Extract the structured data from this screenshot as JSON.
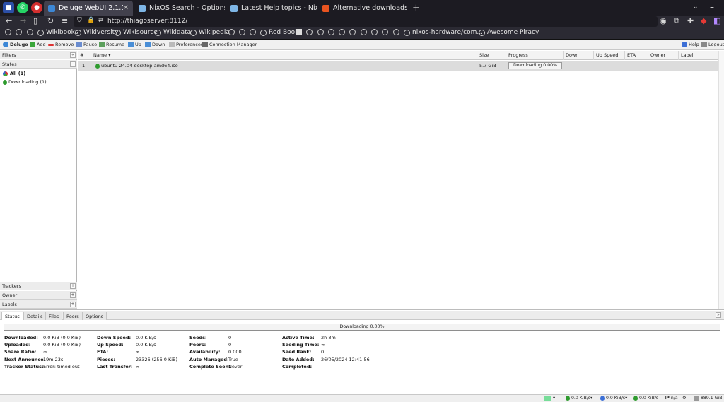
{
  "browser": {
    "tabs": [
      {
        "label": "Deluge WebUI 2.1.1",
        "active": true
      },
      {
        "label": "NixOS Search - Options - al"
      },
      {
        "label": "Latest Help topics - NixOS D"
      },
      {
        "label": "Alternative downloads | Ubu"
      }
    ],
    "url": "http://thiagoserver:8112/",
    "bookmarks": [
      "Wikibooks",
      "Wikiversity",
      "Wikisource",
      "Wikidata",
      "Wikipedia",
      "Red Book",
      "nixos-hardware/com...",
      "Awesome Piracy"
    ]
  },
  "toolbar": {
    "app": "Deluge",
    "add": "Add",
    "remove": "Remove",
    "pause": "Pause",
    "resume": "Resume",
    "up": "Up",
    "down": "Down",
    "preferences": "Preferences",
    "connection_manager": "Connection Manager",
    "help": "Help",
    "logout": "Logout"
  },
  "sidebar": {
    "filters": "Filters",
    "states": "States",
    "state_items": [
      "All (1)",
      "Downloading (1)"
    ],
    "trackers": "Trackers",
    "owner": "Owner",
    "labels": "Labels"
  },
  "grid": {
    "columns": [
      "#",
      "Name",
      "Size",
      "Progress",
      "Down Speed",
      "Up Speed",
      "ETA",
      "Owner",
      "Label"
    ],
    "sort_indicator": "▾",
    "rows": [
      {
        "num": "1",
        "name": "ubuntu-24.04-desktop-amd64.iso",
        "size": "5.7 GiB",
        "progress_text": "Downloading 0.00%",
        "progress": 0
      }
    ]
  },
  "details": {
    "tabs": [
      "Status",
      "Details",
      "Files",
      "Peers",
      "Options"
    ],
    "progress_text": "Downloading 0.00%",
    "col1": [
      {
        "label": "Downloaded:",
        "value": "0.0 KiB (0.0 KiB)"
      },
      {
        "label": "Uploaded:",
        "value": "0.0 KiB (0.0 KiB)"
      },
      {
        "label": "Share Ratio:",
        "value": "∞"
      },
      {
        "label": "Next Announce:",
        "value": "19m 23s"
      },
      {
        "label": "Tracker Status:",
        "value": "Error: timed out"
      }
    ],
    "col2": [
      {
        "label": "Down Speed:",
        "value": "0.0 KiB/s"
      },
      {
        "label": "Up Speed:",
        "value": "0.0 KiB/s"
      },
      {
        "label": "ETA:",
        "value": "∞"
      },
      {
        "label": "Pieces:",
        "value": "23326 (256.0 KiB)"
      },
      {
        "label": "Last Transfer:",
        "value": "∞"
      }
    ],
    "col3": [
      {
        "label": "Seeds:",
        "value": "0"
      },
      {
        "label": "Peers:",
        "value": "0"
      },
      {
        "label": "Availability:",
        "value": "0.000"
      },
      {
        "label": "Auto Managed:",
        "value": "True"
      },
      {
        "label": "Complete Seen:",
        "value": "Never"
      }
    ],
    "col4": [
      {
        "label": "Active Time:",
        "value": "2h 8m"
      },
      {
        "label": "Seeding Time:",
        "value": "∞"
      },
      {
        "label": "Seed Rank:",
        "value": "0"
      },
      {
        "label": "Date Added:",
        "value": "26/05/2024 12:41:56"
      },
      {
        "label": "Completed:",
        "value": ""
      }
    ]
  },
  "statusbar": {
    "down": "0.0 KiB/s",
    "up": "0.0 KiB/s",
    "traffic": "0.0 KiB/s",
    "ip": "IP",
    "ip_value": "n/a",
    "free_space": "889.1 GiB"
  },
  "colors": {
    "accent": "#3c87d6",
    "downloading_green": "#2e9b2e",
    "tabbar_bg": "#1c1b22"
  }
}
